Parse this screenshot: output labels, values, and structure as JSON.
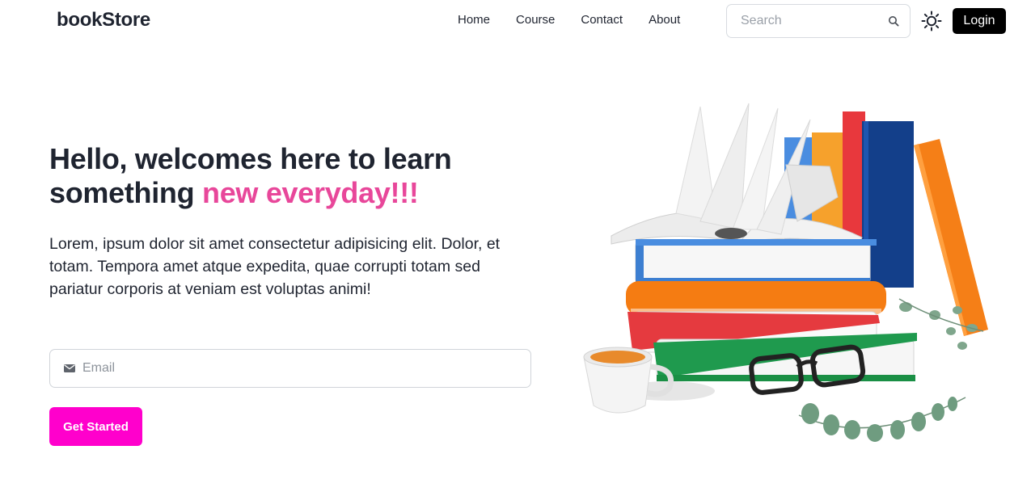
{
  "navbar": {
    "brand": "bookStore",
    "links": [
      "Home",
      "Course",
      "Contact",
      "About"
    ],
    "search": {
      "placeholder": "Search",
      "value": ""
    },
    "login_label": "Login"
  },
  "hero": {
    "title_part1": "Hello, welcomes here to learn something ",
    "title_accent": "new everyday!!!",
    "description": "Lorem, ipsum dolor sit amet consectetur adipisicing elit. Dolor, et totam. Tempora amet atque expedita, quae corrupti totam sed pariatur corporis at veniam est voluptas animi!",
    "email": {
      "placeholder": "Email",
      "value": ""
    },
    "cta_label": "Get Started"
  },
  "colors": {
    "accent_pink": "#e8479a",
    "cta_magenta": "#ff00cc",
    "text_dark": "#1f2430",
    "login_bg": "#000000"
  },
  "icons": {
    "search": "search-icon",
    "theme": "sun-icon",
    "email": "envelope-icon"
  }
}
